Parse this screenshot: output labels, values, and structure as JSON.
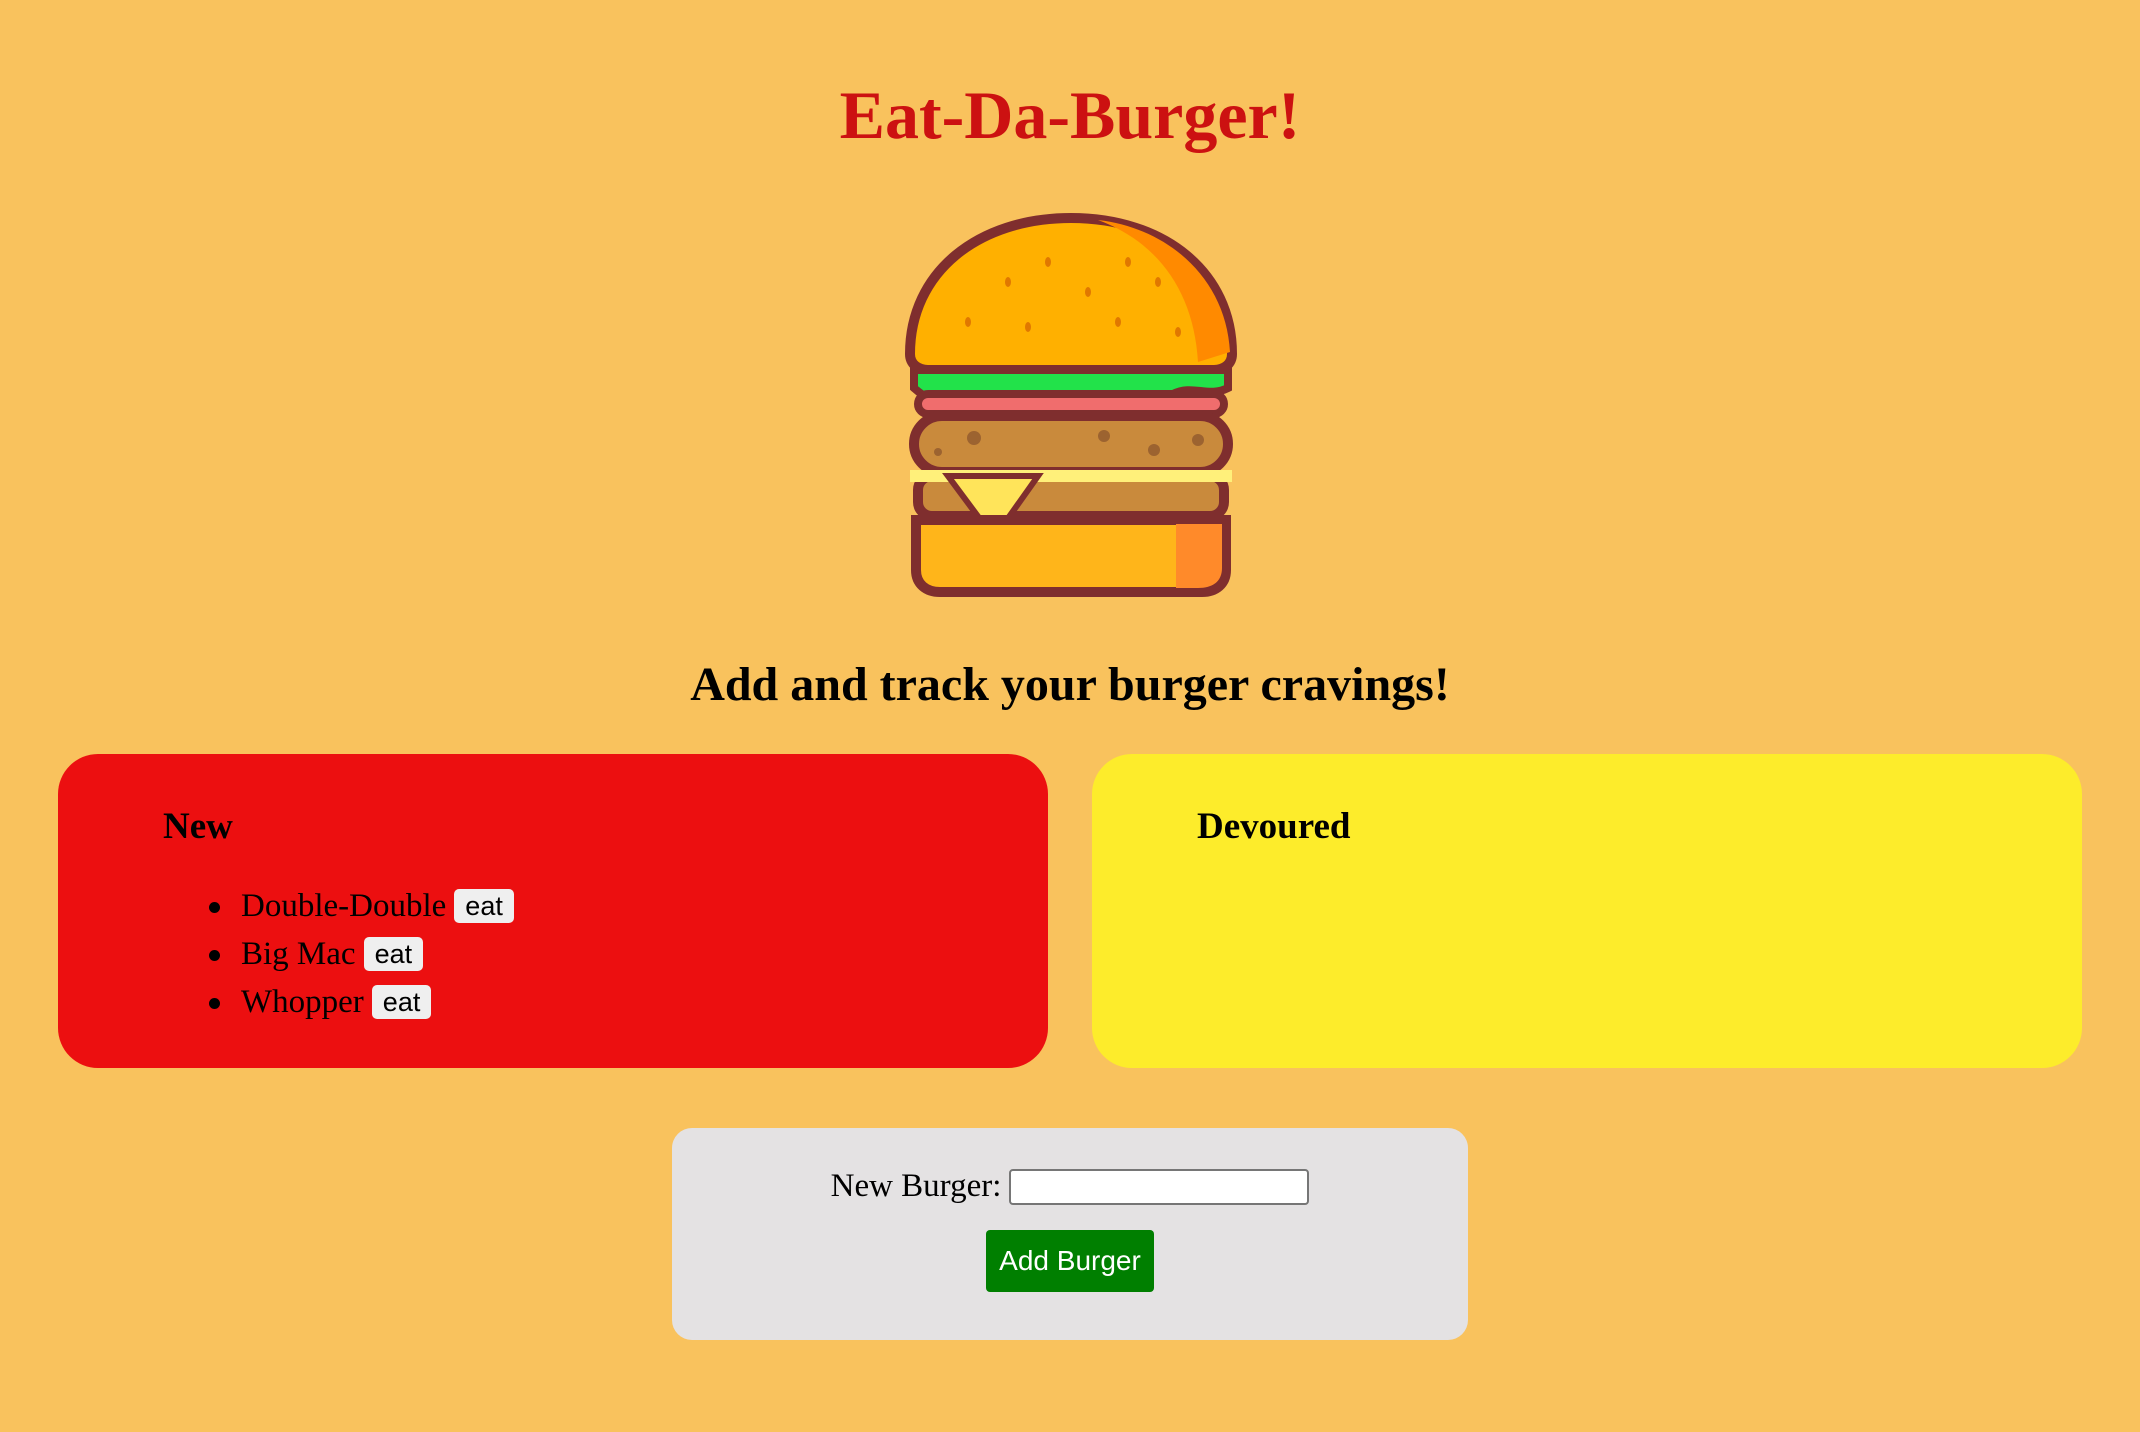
{
  "header": {
    "title": "Eat-Da-Burger!",
    "subtitle": "Add and track your burger cravings!"
  },
  "image": {
    "icon": "burger-icon"
  },
  "panels": {
    "new": {
      "heading": "New",
      "color": "#ec0f10",
      "items": [
        {
          "name": "Double-Double",
          "button": "eat"
        },
        {
          "name": "Big Mac",
          "button": "eat"
        },
        {
          "name": "Whopper",
          "button": "eat"
        }
      ]
    },
    "devoured": {
      "heading": "Devoured",
      "color": "#fdec2b",
      "items": []
    }
  },
  "form": {
    "label": "New Burger:",
    "input_value": "",
    "input_placeholder": "",
    "submit_label": "Add Burger",
    "submit_color": "#007f00"
  },
  "colors": {
    "background": "#f9c25d",
    "title": "#cc1111",
    "form_background": "#e4e2e3"
  }
}
